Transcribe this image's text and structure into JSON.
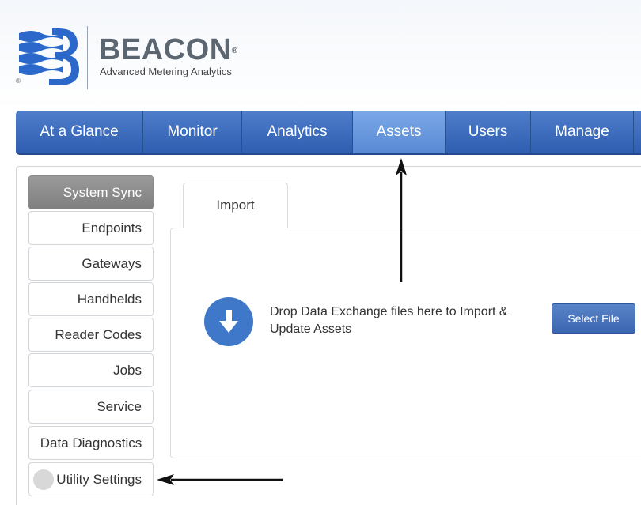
{
  "brand": {
    "name": "BEACON",
    "trademark": "®",
    "tagline": "Advanced Metering Analytics",
    "registered": "®",
    "colors": {
      "stripe": "#2c68c9",
      "text": "#5c6670"
    }
  },
  "nav": {
    "items": [
      {
        "label": "At a Glance",
        "active": false
      },
      {
        "label": "Monitor",
        "active": false
      },
      {
        "label": "Analytics",
        "active": false
      },
      {
        "label": "Assets",
        "active": true
      },
      {
        "label": "Users",
        "active": false
      },
      {
        "label": "Manage",
        "active": false
      }
    ],
    "colors": {
      "bar": "#2f5db0",
      "active": "#6a97dc"
    }
  },
  "sidebar": {
    "items": [
      {
        "label": "System Sync",
        "active": true
      },
      {
        "label": "Endpoints",
        "active": false
      },
      {
        "label": "Gateways",
        "active": false
      },
      {
        "label": "Handhelds",
        "active": false
      },
      {
        "label": "Reader Codes",
        "active": false
      },
      {
        "label": "Jobs",
        "active": false
      },
      {
        "label": "Service",
        "active": false
      },
      {
        "label": "Data Diagnostics",
        "active": false
      },
      {
        "label": "Utility Settings",
        "active": false
      }
    ]
  },
  "import_panel": {
    "tab_label": "Import",
    "drop_icon": "download-arrow-icon",
    "drop_text": "Drop Data Exchange files here to Import & Update Assets",
    "select_button": "Select File"
  },
  "annotations": {
    "arrows": [
      "arrow-pointing-to-assets-tab",
      "arrow-pointing-to-utility-settings"
    ]
  }
}
